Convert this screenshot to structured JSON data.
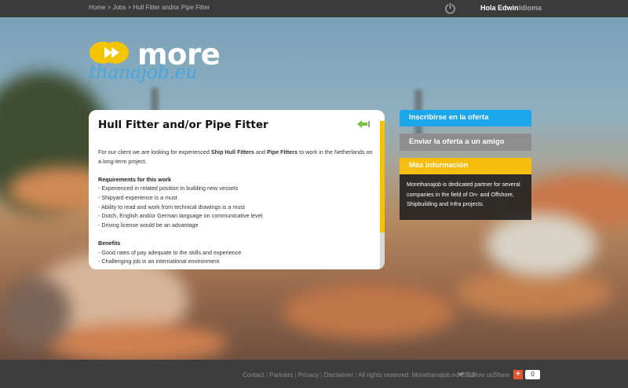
{
  "breadcrumb": {
    "home": "Home",
    "sep1": " > ",
    "jobs": "Jobs",
    "sep2": " > ",
    "current": "Hull Fitter and/or Pipe Fitter"
  },
  "topbar": {
    "power_icon": "power-icon",
    "greeting": "Hola Edwin",
    "language": "Idioma"
  },
  "logo": {
    "word": "more",
    "tagline": "thanajob.eu",
    "colors": {
      "mark": "#f5c400",
      "tagline": "#46a7e1"
    }
  },
  "job": {
    "title": "Hull Fitter and/or Pipe Fitter",
    "back_icon": "back-arrow-icon",
    "intro_a": "For our client we are looking for experienced ",
    "intro_b": "Ship Hull Fitters",
    "intro_c": " and ",
    "intro_d": "Pipe Fitters",
    "intro_e": " to work in the Netherlands on a long-term project.",
    "requirements_heading": "Requirements for this work",
    "requirements": [
      "- Experienced in related position in building new vessels",
      "- Shipyard experience is a must",
      "- Ability to read and work from technical drawings is a must",
      "- Dutch, English and/or German language on communicative level",
      "- Driving license would be an advantage"
    ],
    "benefits_heading": "Benefits",
    "benefits": [
      "- Good rates of pay adequate to the skills and experience",
      "- Challenging job in an international environment"
    ]
  },
  "sidebar": {
    "apply_label": "Inscribirse en la oferta",
    "send_label": "Enviar la oferta a un amigo",
    "info_heading": "Más información",
    "info_text": "Morethanajob is dedicated partner for several companies in the field of On- and Offshore, Shipbuilding and Infra projects.",
    "colors": {
      "apply": "#1ca6ec",
      "send": "#8e8e8e",
      "info": "#f6bd0f"
    }
  },
  "footer": {
    "contact": "Contact",
    "partners": "Partners",
    "privacy": "Privacy",
    "disclaimer": "Disclaimer",
    "rights": "All rights reserved: Morethanajob.eu 2013",
    "follow": "Follow us",
    "share": "Share",
    "share_plus": "+",
    "share_count": "0"
  }
}
